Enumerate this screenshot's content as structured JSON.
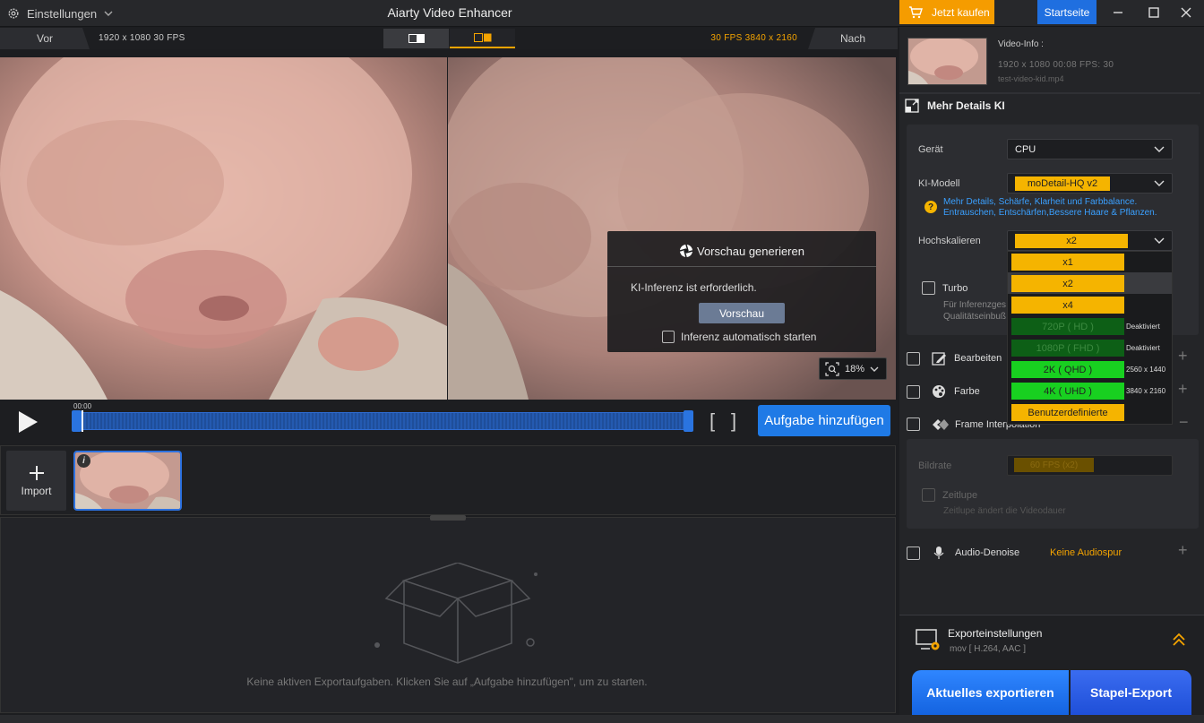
{
  "titlebar": {
    "settings_label": "Einstellungen",
    "app_title": "Aiarty Video Enhancer",
    "buy_label": "Jetzt kaufen",
    "home_label": "Startseite"
  },
  "preview": {
    "before_label": "Vor",
    "after_label": "Nach",
    "source_info": "1920 x 1080  30 FPS",
    "target_info": "30 FPS  3840 x 2160",
    "zoom": "18%"
  },
  "generate": {
    "title": "Vorschau generieren",
    "message": "KI-Inferenz ist erforderlich.",
    "button": "Vorschau",
    "auto_label": "Inferenz automatisch starten"
  },
  "timeline": {
    "time": "00:00",
    "add_task": "Aufgabe hinzufügen"
  },
  "media": {
    "import_label": "Import"
  },
  "export_area": {
    "empty_message": "Keine aktiven Exportaufgaben. Klicken Sie auf „Aufgabe hinzufügen\", um zu starten."
  },
  "video_info": {
    "title": "Video-Info :",
    "meta": "1920 x 1080  00:08   FPS: 30",
    "file": "test-video-kid.mp4"
  },
  "ki": {
    "header": "Mehr Details KI",
    "device_label": "Gerät",
    "device_value": "CPU",
    "model_label": "KI-Modell",
    "model_value": "moDetail-HQ  v2",
    "model_desc_1": "Mehr Details, Schärfe, Klarheit und Farbbalance.",
    "model_desc_2": "Entrauschen, Entschärfen,Bessere Haare & Pflanzen.",
    "upscale_label": "Hochskalieren",
    "upscale_value": "x2",
    "turbo_label": "Turbo",
    "turbo_desc_1": "Für Inferenzges",
    "turbo_desc_2": "Qualitätseinbuß"
  },
  "scale_options": [
    {
      "label": "x1",
      "note": ""
    },
    {
      "label": "x2",
      "note": ""
    },
    {
      "label": "x4",
      "note": ""
    },
    {
      "label": "720P ( HD )",
      "note": "Deaktiviert"
    },
    {
      "label": "1080P ( FHD )",
      "note": "Deaktiviert"
    },
    {
      "label": "2K ( QHD )",
      "note": "2560 x 1440"
    },
    {
      "label": "4K ( UHD )",
      "note": "3840 x 2160"
    },
    {
      "label": "Benutzerdefinierte",
      "note": ""
    }
  ],
  "features": {
    "edit": "Bearbeiten",
    "color": "Farbe",
    "frame_interp": "Frame Interpolation",
    "framerate_label": "Bildrate",
    "framerate_value": "60 FPS  (x2)",
    "slowmo_label": "Zeitlupe",
    "slowmo_desc": "Zeitlupe ändert die Videodauer",
    "audio": "Audio-Denoise",
    "audio_status": "Keine Audiospur"
  },
  "export": {
    "settings_label": "Exporteinstellungen",
    "format": "mov [ H.264, AAC ]",
    "current_btn": "Aktuelles exportieren",
    "batch_btn": "Stapel-Export"
  },
  "colors": {
    "accent_orange": "#f5a400",
    "accent_blue": "#1f7ae6",
    "opt_yellow": "#f5b400",
    "opt_dark_green": "#0d5f16",
    "opt_bright_green": "#18d020"
  }
}
